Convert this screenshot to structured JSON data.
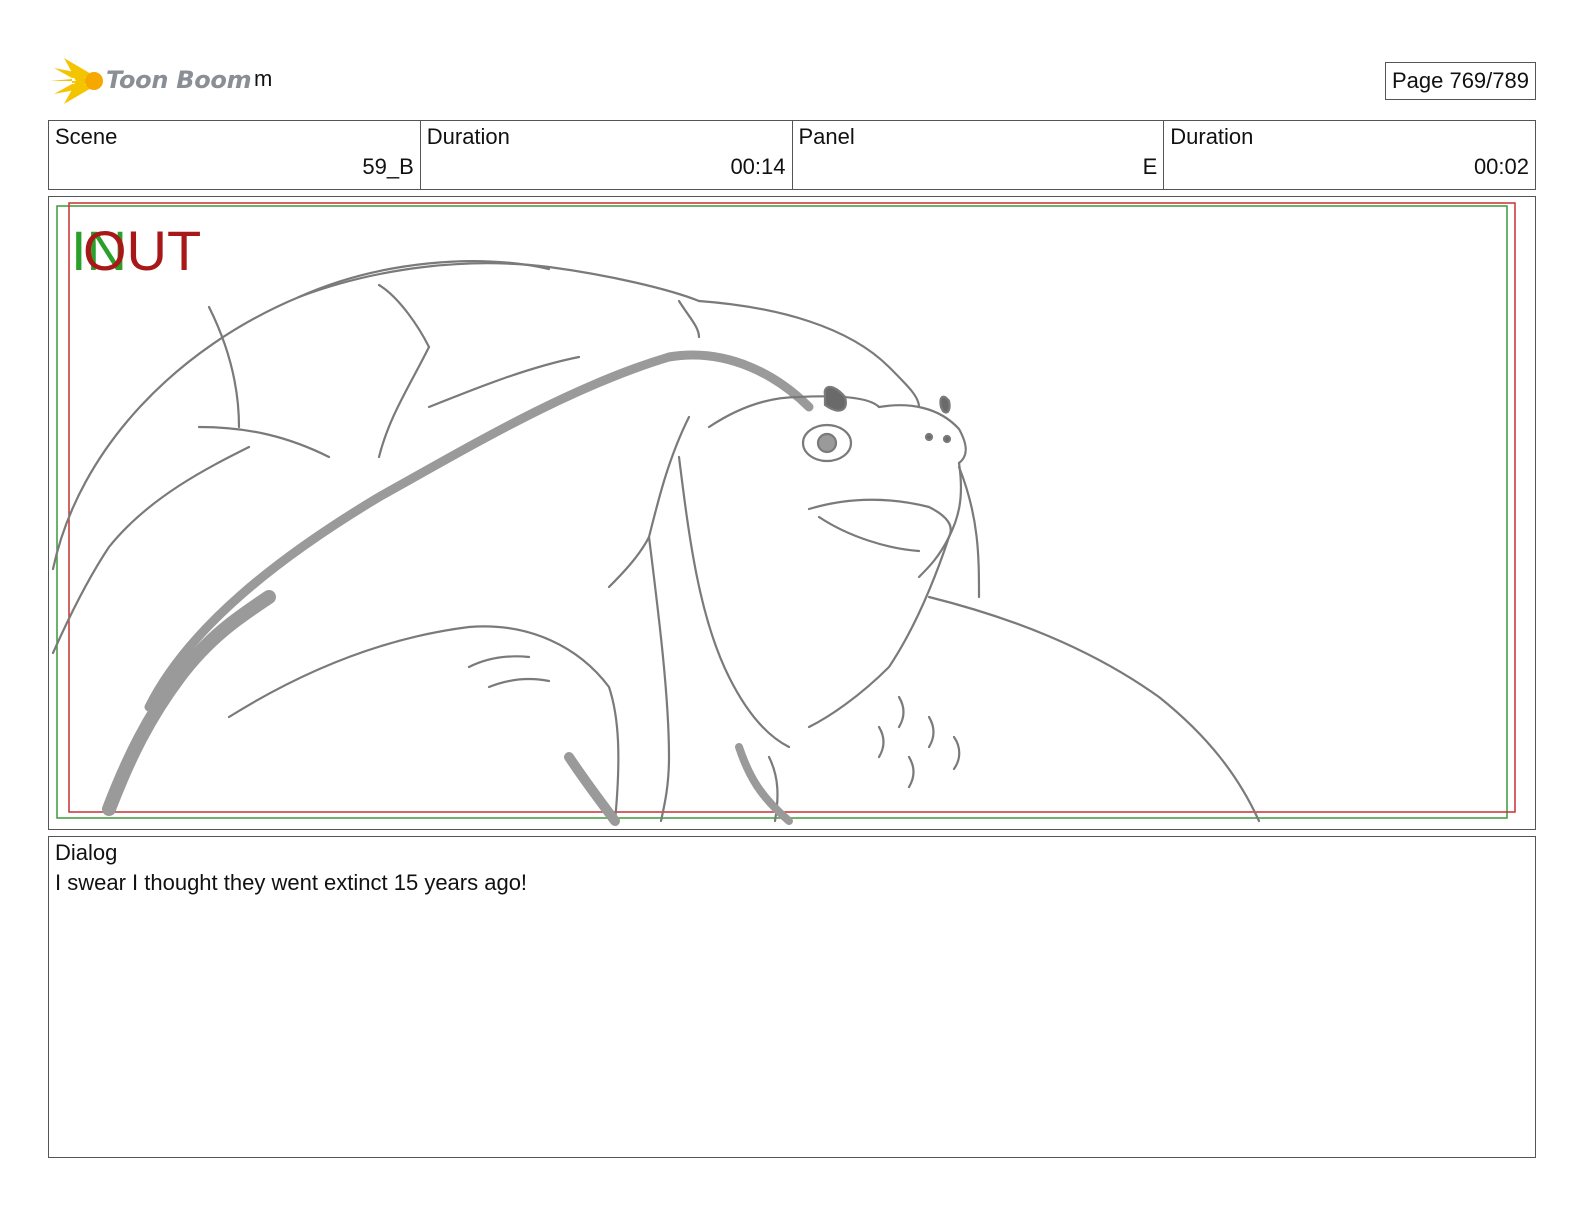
{
  "header": {
    "logo_text": "Toon Boom",
    "project_name": "m",
    "page_indicator": "Page 769/789"
  },
  "info": {
    "scene_label": "Scene",
    "scene_value": "59_B",
    "scene_duration_label": "Duration",
    "scene_duration_value": "00:14",
    "panel_label": "Panel",
    "panel_value": "E",
    "panel_duration_label": "Duration",
    "panel_duration_value": "00:02"
  },
  "panel_overlay": {
    "in_label": "IN",
    "out_label": "OUT",
    "in_color": "#2aa02a",
    "out_color": "#a81818"
  },
  "dialog": {
    "label": "Dialog",
    "text": "I swear I thought they went extinct 15 years ago!"
  }
}
